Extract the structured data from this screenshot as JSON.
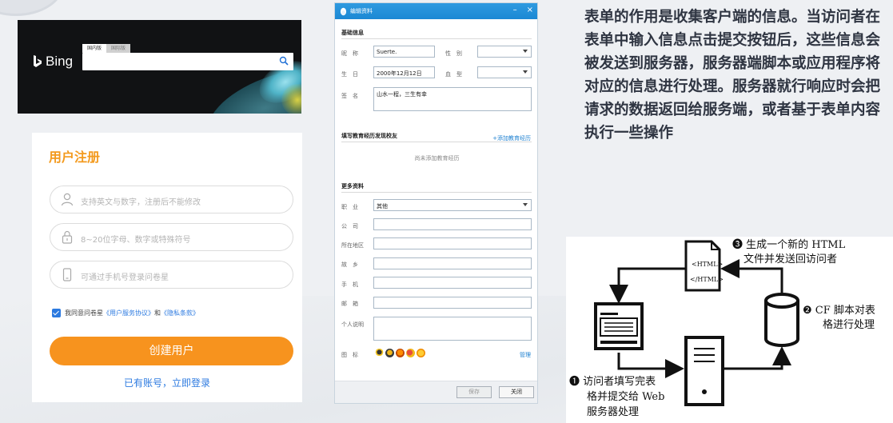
{
  "bing": {
    "logo_text": "Bing",
    "tab_cn": "国内版",
    "tab_intl": "国际版"
  },
  "register": {
    "title": "用户注册",
    "username_placeholder": "支持英文与数字，注册后不能修改",
    "password_placeholder": "8~20位字母、数字或特殊符号",
    "phone_placeholder": "可通过手机号登录问卷星",
    "agree_prefix": "我同意问卷星",
    "terms_link": "《用户服务协议》",
    "and": "和",
    "privacy_link": "《隐私条款》",
    "agreed": true,
    "submit_label": "创建用户",
    "login_link": "已有账号，立即登录"
  },
  "qq_dialog": {
    "window_title": "编辑资料",
    "min_label": "–",
    "close_label": "×",
    "basic_header": "基础信息",
    "nickname_label": "昵　称",
    "nickname_value": "Suerte.",
    "gender_label": "性　别",
    "gender_value": "",
    "birthday_label": "生　日",
    "birthday_value": "2000年12月12日",
    "blood_label": "血　型",
    "blood_value": "",
    "signature_label": "签　名",
    "signature_value": "山水一程，三生有幸",
    "edu_header": "填写教育经历发现校友",
    "add_edu_link": "+添加教育经历",
    "edu_empty": "尚未添加教育经历",
    "more_header": "更多资料",
    "job_label": "职　业",
    "job_value": "其他",
    "company_label": "公　司",
    "location_label": "所在地区",
    "hometown_label": "故　乡",
    "phone_label": "手　机",
    "email_label": "邮　箱",
    "bio_label": "个人说明",
    "icons_label": "图　标",
    "manage_link": "管理",
    "save_label": "保存",
    "close_button_label": "关闭"
  },
  "description": "表单的作用是收集客户端的信息。当访问者在表单中输入信息点击提交按钮后，这些信息会被发送到服务器，服务器端脚本或应用程序将对应的信息进行处理。服务器就行响应时会把请求的数据返回给服务端，或者基于表单内容执行一些操作",
  "diagram": {
    "step3_line1": "❸ 生成一个新的 HTML",
    "step3_line2": "文件并发送回访问者",
    "step2_line1": "❷ CF 脚本对表",
    "step2_line2": "格进行处理",
    "step1_line1": "❶ 访问者填写完表",
    "step1_line2": "格并提交给 Web",
    "step1_line3": "服务器处理",
    "html_tag_open": "<HTML>",
    "html_tag_close": "</HTML>"
  }
}
